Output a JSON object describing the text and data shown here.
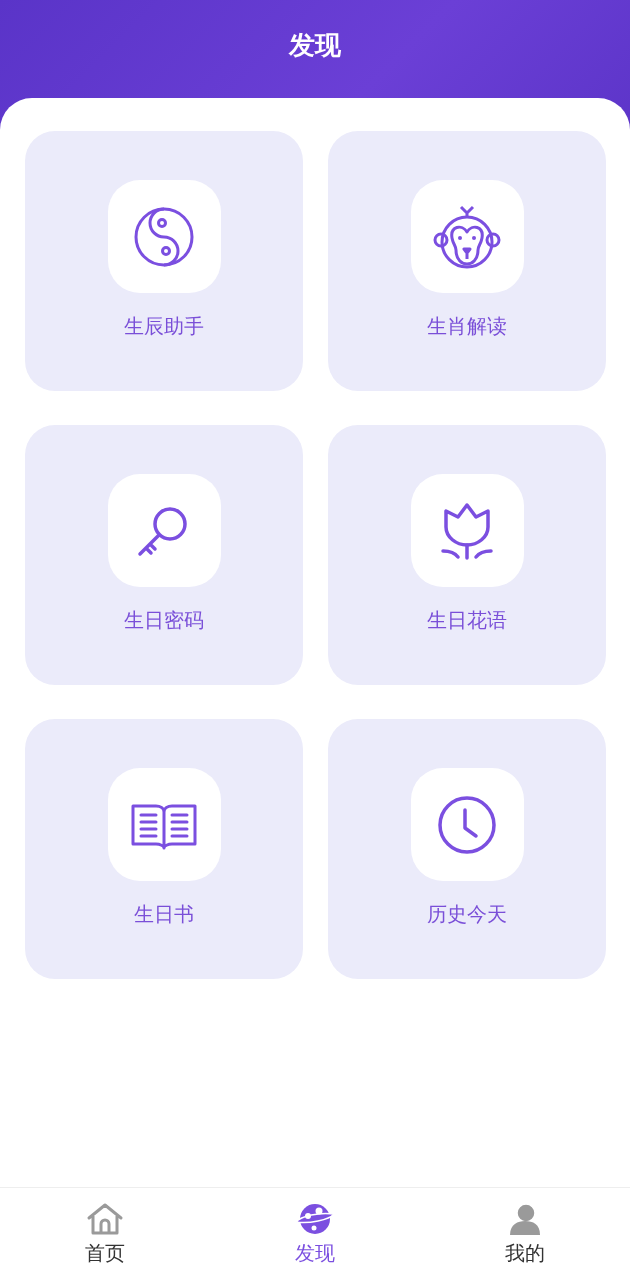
{
  "header": {
    "title": "发现"
  },
  "tools": [
    {
      "label": "生辰助手"
    },
    {
      "label": "生肖解读"
    },
    {
      "label": "生日密码"
    },
    {
      "label": "生日花语"
    },
    {
      "label": "生日书"
    },
    {
      "label": "历史今天"
    }
  ],
  "tab_bar": [
    {
      "label": "首页",
      "selected": false
    },
    {
      "label": "发现",
      "selected": true
    },
    {
      "label": "我的",
      "selected": false
    }
  ]
}
